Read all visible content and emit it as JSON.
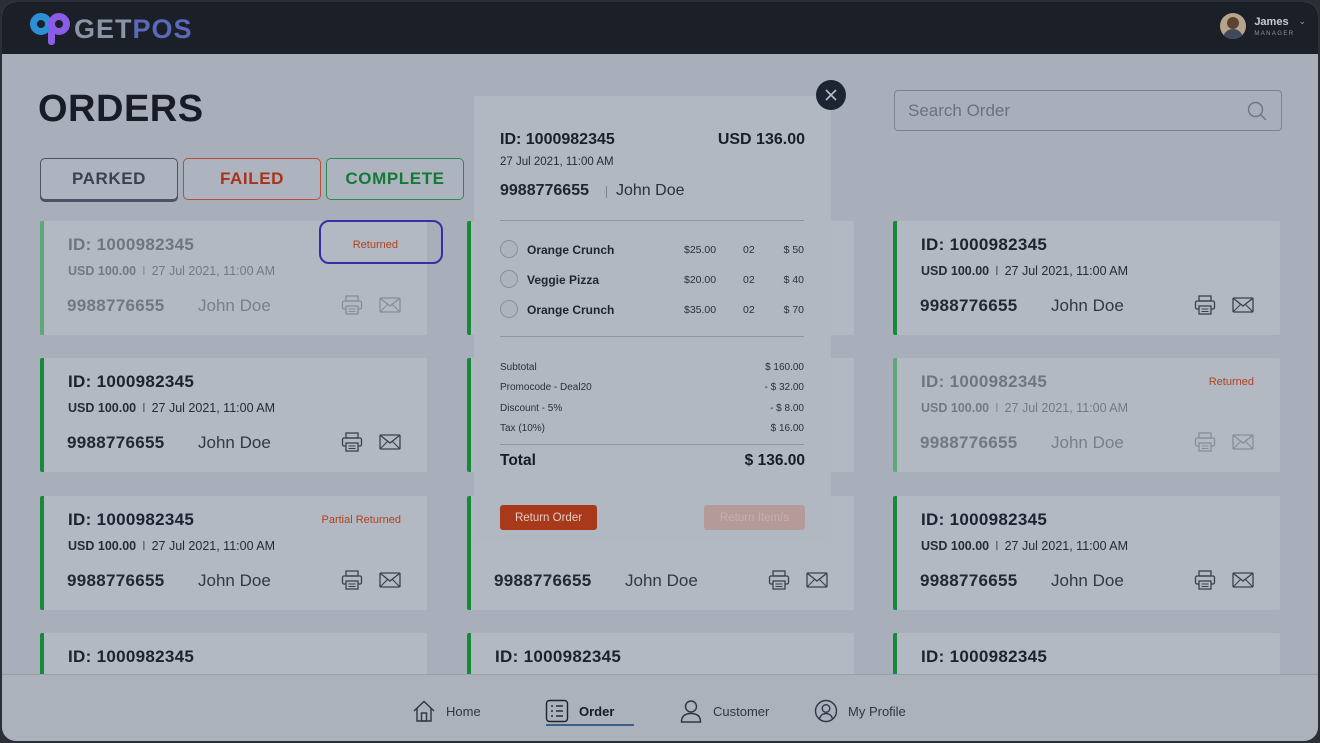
{
  "app": {
    "logo_text_a": "GET",
    "logo_text_b": "POS"
  },
  "user": {
    "name": "James",
    "role": "MANAGER"
  },
  "page": {
    "title": "ORDERS"
  },
  "search": {
    "placeholder": "Search Order"
  },
  "tabs": [
    {
      "label": "PARKED"
    },
    {
      "label": "FAILED"
    },
    {
      "label": "COMPLETE"
    }
  ],
  "cards": [
    {
      "id": "ID: 1000982345",
      "amount": "USD 100.00",
      "date": "27 Jul 2021, 11:00 AM",
      "phone": "9988776655",
      "name": "John Doe",
      "status": "Returned"
    },
    {
      "id": "ID: 1000982345",
      "amount": "USD 100.00",
      "date": "27 Jul 2021, 11:00 AM",
      "phone": "9988776655",
      "name": "John Doe",
      "status": ""
    },
    {
      "id": "ID: 1000982345",
      "amount": "USD 100.00",
      "date": "27 Jul 2021, 11:00 AM",
      "phone": "9988776655",
      "name": "John Doe",
      "status": ""
    },
    {
      "id": "ID: 1000982345",
      "amount": "USD 100.00",
      "date": "27 Jul 2021, 11:00 AM",
      "phone": "9988776655",
      "name": "John Doe",
      "status": "Returned"
    },
    {
      "id": "ID: 1000982345",
      "amount": "USD 100.00",
      "date": "27 Jul 2021, 11:00 AM",
      "phone": "9988776655",
      "name": "John Doe",
      "status": "Partial Returned"
    },
    {
      "id": "",
      "amount": "",
      "date": "",
      "phone": "9988776655",
      "name": "John Doe",
      "status": ""
    },
    {
      "id": "ID: 1000982345",
      "amount": "USD 100.00",
      "date": "27 Jul 2021, 11:00 AM",
      "phone": "9988776655",
      "name": "John Doe",
      "status": ""
    },
    {
      "id": "ID: 1000982345"
    },
    {
      "id": "ID: 1000982345"
    },
    {
      "id": "ID: 1000982345"
    }
  ],
  "modal": {
    "id": "ID: 1000982345",
    "total_top": "USD 136.00",
    "date": "27 Jul 2021, 11:00 AM",
    "phone": "9988776655",
    "name": "John Doe",
    "items": [
      {
        "name": "Orange Crunch",
        "price": "$25.00",
        "qty": "02",
        "line": "$ 50"
      },
      {
        "name": "Veggie Pizza",
        "price": "$20.00",
        "qty": "02",
        "line": "$ 40"
      },
      {
        "name": "Orange Crunch",
        "price": "$35.00",
        "qty": "02",
        "line": "$ 70"
      }
    ],
    "summary": [
      {
        "label": "Subtotal",
        "value": "$ 160.00"
      },
      {
        "label": "Promocode - Deal20",
        "value": "- $ 32.00"
      },
      {
        "label": "Discount - 5%",
        "value": "- $ 8.00"
      },
      {
        "label": "Tax (10%)",
        "value": "$ 16.00"
      }
    ],
    "total_label": "Total",
    "total_value": "$ 136.00",
    "return_order_label": "Return Order",
    "return_items_label": "Return Item/s"
  },
  "nav": [
    {
      "label": "Home",
      "icon": "home-icon"
    },
    {
      "label": "Order",
      "icon": "order-list-icon",
      "active": true
    },
    {
      "label": "Customer",
      "icon": "customer-icon"
    },
    {
      "label": "My Profile",
      "icon": "profile-icon"
    }
  ],
  "colors": {
    "accent_green": "#178a3a",
    "status_red": "#b2401e",
    "return_button": "#a8391a",
    "highlight_ring": "#3d2ca8"
  }
}
